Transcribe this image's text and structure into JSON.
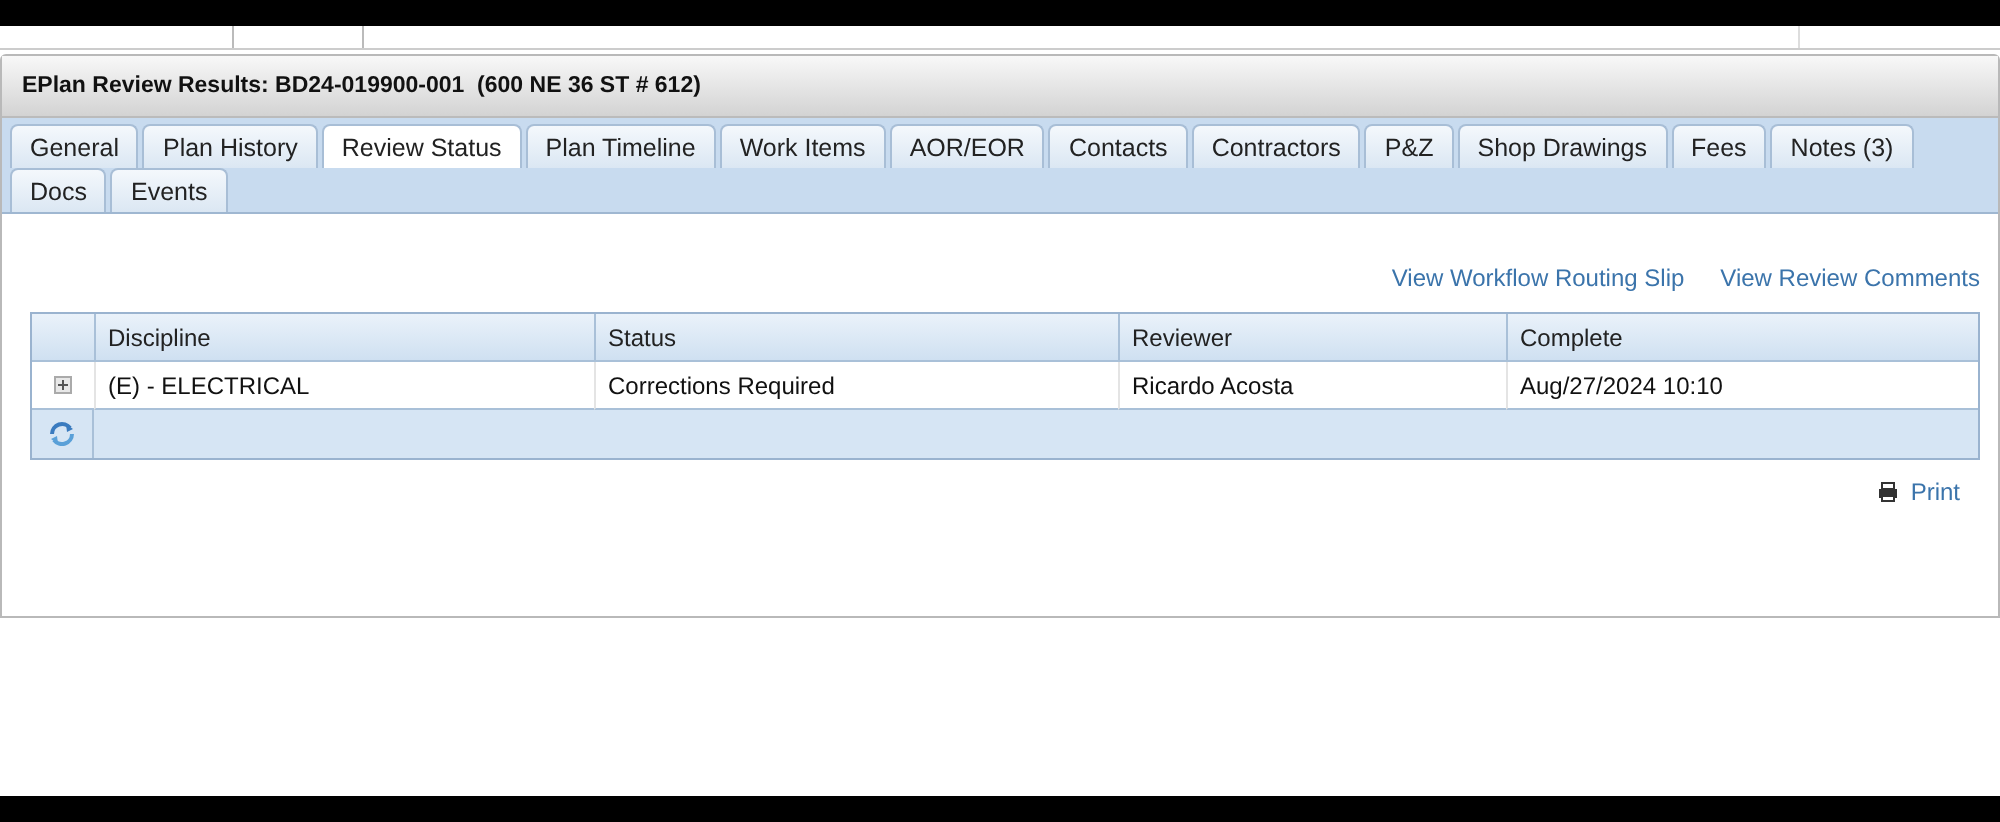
{
  "panel": {
    "title": "EPlan Review Results: BD24-019900-001  (600 NE 36 ST # 612)"
  },
  "tabs": [
    [
      {
        "label": "General",
        "selected": false
      },
      {
        "label": "Plan History",
        "selected": false
      },
      {
        "label": "Review Status",
        "selected": true
      },
      {
        "label": "Plan Timeline",
        "selected": false
      },
      {
        "label": "Work Items",
        "selected": false
      },
      {
        "label": "AOR/EOR",
        "selected": false
      },
      {
        "label": "Contacts",
        "selected": false
      },
      {
        "label": "Contractors",
        "selected": false
      },
      {
        "label": "P&Z",
        "selected": false
      },
      {
        "label": "Shop Drawings",
        "selected": false
      },
      {
        "label": "Fees",
        "selected": false
      },
      {
        "label": "Notes (3)",
        "selected": false
      }
    ],
    [
      {
        "label": "Docs",
        "selected": false
      },
      {
        "label": "Events",
        "selected": false
      }
    ]
  ],
  "links": [
    "View Workflow Routing Slip",
    "View Review Comments"
  ],
  "table": {
    "columns": [
      "Discipline",
      "Status",
      "Reviewer",
      "Complete"
    ],
    "rows": [
      {
        "expanded": false,
        "cells": [
          "(E) - ELECTRICAL",
          "Corrections Required",
          "Ricardo Acosta",
          "Aug/27/2024 10:10"
        ]
      }
    ]
  },
  "print": "Print"
}
